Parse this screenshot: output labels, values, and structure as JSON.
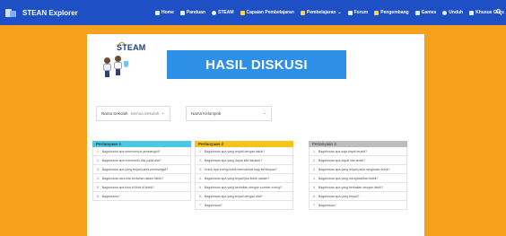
{
  "navbar": {
    "brand": "STEAN Explorer",
    "items": [
      {
        "label": "Home",
        "icon": "home-icon"
      },
      {
        "label": "Panduan",
        "icon": "book-icon"
      },
      {
        "label": "STEAM",
        "icon": "atom-icon"
      },
      {
        "label": "Capaian Pembelajaran",
        "icon": "trophy-icon"
      },
      {
        "label": "Pembelajaran",
        "icon": "lesson-icon",
        "dropdown": true
      },
      {
        "label": "Forum",
        "icon": "chat-icon"
      },
      {
        "label": "Pengembang",
        "icon": "team-icon"
      },
      {
        "label": "Games",
        "icon": "game-icon"
      },
      {
        "label": "Unduh",
        "icon": "download-icon"
      },
      {
        "label": "Khusus Guru",
        "icon": "teacher-icon"
      }
    ]
  },
  "logo": {
    "text": "STEAM"
  },
  "banner": {
    "title": "HASIL DISKUSI"
  },
  "filters": {
    "school_label": "Nama Sekolah",
    "school_value": "Semua Sekolah",
    "group_label": "Nama Kelompok"
  },
  "columns": [
    {
      "title": "Pertanyaan 1",
      "questions": [
        "Bagaimana apa sebenarnya pembangkit?",
        "Bagaimana apa membantu kita pada alat?",
        "Bagaimana apa yang terjadi pada pembangkit?",
        "Bagaimana cara kita bertahan dalam listrik?",
        "Bagaimana apa bisa di lihat di listrik?",
        "Bagaimana?"
      ]
    },
    {
      "title": "Pertanyaan 2",
      "questions": [
        "Bagaimana apa yang terjadi dengan listrik?",
        "Bagaimana apa yang dapat kita lakukan?",
        "Untuk apa energi listrik bermanfaat bagi kehidupan?",
        "Bagaimana apa yang terjadi jika listrik padam?",
        "Bagaimana apa yang berkaitan dengan sumber energi?",
        "Bagaimana apa yang terjadi dengan alat?",
        "Bagaimana?"
      ]
    },
    {
      "title": "Pertanyaan 3",
      "questions": [
        "Bagaimana apa saja dapat terjadi?",
        "Bagaimana apa dapat kita amati?",
        "Bagaimana apa yang terjadi pada rangkaian listrik?",
        "Bagaimana apa yang menghasilkan listrik?",
        "Bagaimana apa yang berkaitan dengan listrik?",
        "Bagaimana apa yang terjadi?",
        "Bagaimana?"
      ]
    }
  ],
  "colors": {
    "navbar": "#1f4fc4",
    "page_bg": "#f5a11c",
    "banner": "#2e8fe6",
    "col1_header": "#4cc8e4",
    "col2_header": "#f7c31b",
    "col3_header": "#bdbdbd"
  }
}
